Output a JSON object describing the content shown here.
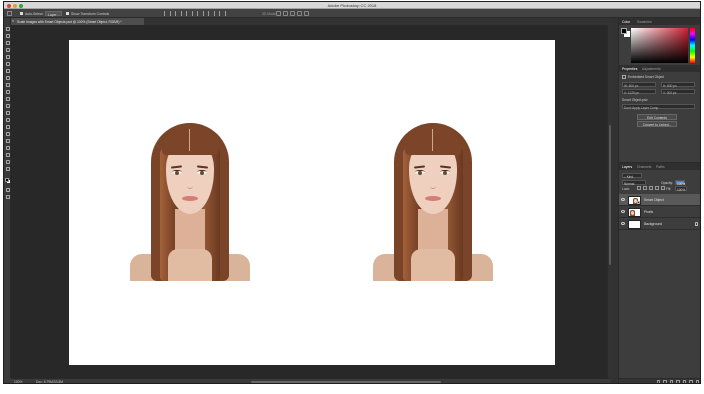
{
  "app": {
    "window_title": "Adobe Photoshop CC 2018"
  },
  "options_bar": {
    "auto_select_label": "Auto-Select:",
    "auto_select_target": "Layer",
    "show_transform_label": "Show Transform Controls",
    "mode_3d_label": "3D Mode:"
  },
  "document_tab": {
    "label": "Scale Images with Smart Objects.psd @ 100% (Smart Object, RGB/8) *"
  },
  "status_bar": {
    "zoom": "100%",
    "doc_size": "Doc: 8.79M/33.0M"
  },
  "color_panel": {
    "tabs": [
      "Color",
      "Swatches"
    ],
    "foreground_color": "#000000",
    "background_color": "#ffffff"
  },
  "properties_panel": {
    "tabs": [
      "Properties",
      "Adjustments"
    ],
    "type_label": "Embedded Smart Object",
    "w_value": "W: 600 px",
    "h_value": "H: 800 px",
    "x_value": "X: 1125 px",
    "y_value": "Y: 300 px",
    "source_file": "Smart Object.psb",
    "layer_comp_placeholder": "Don't Apply Layer Comp",
    "edit_contents_label": "Edit Contents",
    "convert_to_linked_label": "Convert to Linked..."
  },
  "layers_panel": {
    "tabs": [
      "Layers",
      "Channels",
      "Paths"
    ],
    "filter_kind": "Kind",
    "blend_mode": "Normal",
    "opacity_label": "Opacity:",
    "opacity_value": "100%",
    "lock_label": "Lock:",
    "fill_label": "Fill:",
    "fill_value": "100%",
    "layers": [
      {
        "name": "Smart Object",
        "selected": true,
        "thumb": "portrait-smart",
        "locked": false
      },
      {
        "name": "Pixels",
        "selected": false,
        "thumb": "portrait",
        "locked": false
      },
      {
        "name": "Background",
        "selected": false,
        "thumb": "white",
        "locked": true
      }
    ]
  }
}
